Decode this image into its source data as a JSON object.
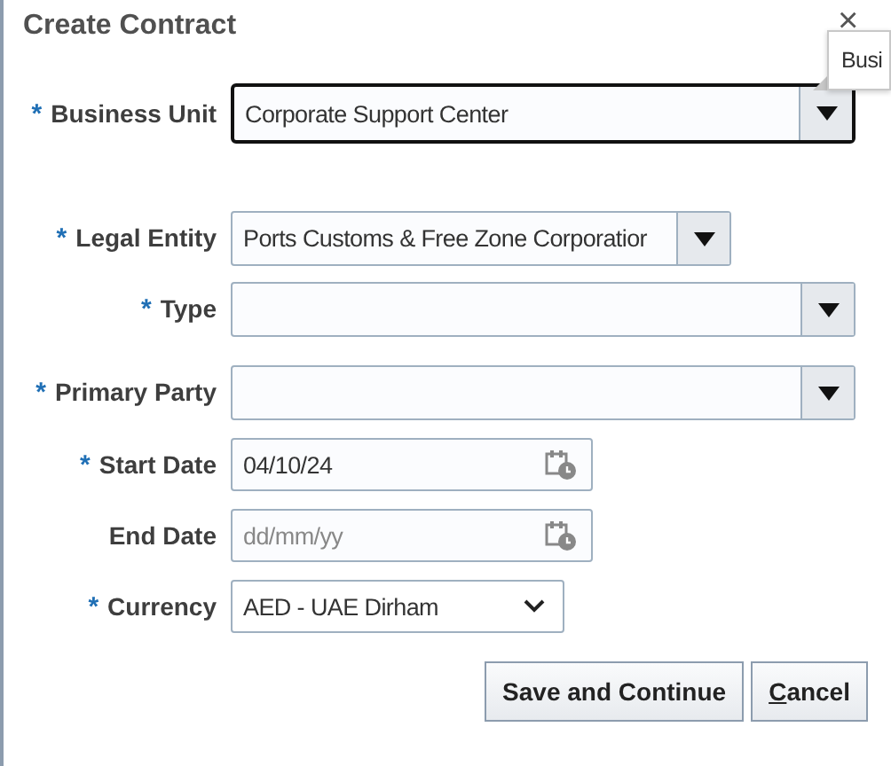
{
  "dialog": {
    "title": "Create Contract",
    "close": "×"
  },
  "tooltip": {
    "text": "Busi"
  },
  "fields": [
    {
      "kind": "combo",
      "label": "Business Unit",
      "required_mark": "*",
      "value": "Corporate Support Center",
      "focused": true
    },
    {
      "kind": "combo",
      "label": "Legal Entity",
      "required_mark": "*",
      "value": "Ports Customs & Free Zone Corporatior",
      "focused": false
    },
    {
      "kind": "combo",
      "label": "Type",
      "required_mark": "*",
      "focused": false
    },
    {
      "kind": "combo",
      "label": "Primary Party",
      "required_mark": "*",
      "focused": false
    },
    {
      "kind": "date",
      "label": "Start Date",
      "required_mark": "*",
      "value": "04/10/24"
    },
    {
      "kind": "date",
      "label": "End Date",
      "placeholder": "dd/mm/yy"
    },
    {
      "kind": "select",
      "label": "Currency",
      "required_mark": "*",
      "value": "AED - UAE Dirham"
    }
  ],
  "buttons": [
    {
      "label": "Save and Continue",
      "access_key_underlined": false
    },
    {
      "label": "Cancel",
      "access_key_underlined": true
    }
  ]
}
